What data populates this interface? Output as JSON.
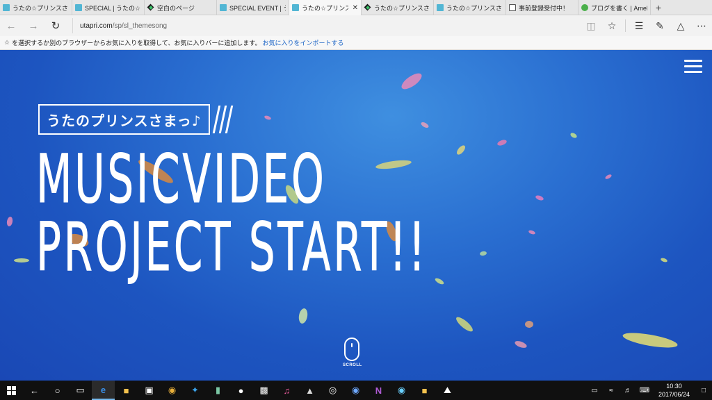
{
  "tabs": [
    {
      "label": "うたの☆プリンスさまっ♪",
      "favicon": "m-icon",
      "active": false,
      "width": 104
    },
    {
      "label": "SPECIAL | うたの☆プリ",
      "favicon": "m-icon",
      "active": false,
      "width": 104
    },
    {
      "label": "空白のページ",
      "favicon": "kite-icon",
      "active": false,
      "width": 104
    },
    {
      "label": "SPECIAL EVENT | うた",
      "favicon": "m-icon",
      "active": false,
      "width": 104
    },
    {
      "label": "うたの☆プリンスさま",
      "favicon": "m-icon",
      "active": true,
      "width": 104
    },
    {
      "label": "うたの☆プリンスさまっ♪",
      "favicon": "kite-icon",
      "active": false,
      "width": 104
    },
    {
      "label": "うたの☆プリンスさまっ♪",
      "favicon": "m-icon",
      "active": false,
      "width": 104
    },
    {
      "label": "事前登録受付中！",
      "favicon": "doc-icon",
      "active": false,
      "width": 104
    },
    {
      "label": "ブログを書く | Ameba",
      "favicon": "ameba-icon",
      "active": false,
      "width": 104
    }
  ],
  "tab_close_glyph": "✕",
  "new_tab_glyph": "+",
  "address": {
    "host": "utapri.com",
    "path": "/sp/sl_themesong"
  },
  "favorites_bar": {
    "star": "☆",
    "message": "を選択するか別のブラウザーからお気に入りを取得して、お気に入りバーに追加します。",
    "link": "お気に入りをインポートする"
  },
  "page": {
    "headline_line1": "MUSICVIDEO",
    "headline_line2": "PROJECT START!!",
    "logo_text": "うたのプリンスさまっ♪",
    "scroll_label": "SCROLL"
  },
  "taskbar": {
    "time": "10:30",
    "date": "2017/06/24"
  }
}
